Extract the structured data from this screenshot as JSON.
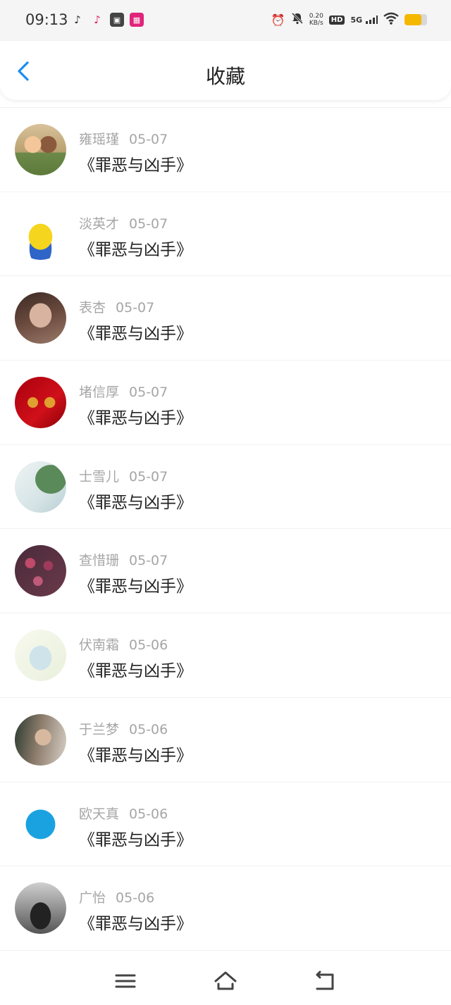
{
  "status_bar": {
    "time": "09:13",
    "speed_value": "0.20",
    "speed_unit": "KB/s",
    "hd_label": "HD",
    "network_label": "5G",
    "battery_level": 0.75,
    "accent": "#f5b800"
  },
  "header": {
    "title": "收藏",
    "back_icon": "chevron-left-icon",
    "accent": "#1b8ef2"
  },
  "favorites": [
    {
      "name": "雍瑶瑾",
      "date": "05-07",
      "book": "《罪恶与凶手》"
    },
    {
      "name": "淡英才",
      "date": "05-07",
      "book": "《罪恶与凶手》"
    },
    {
      "name": "表杏",
      "date": "05-07",
      "book": "《罪恶与凶手》"
    },
    {
      "name": "堵信厚",
      "date": "05-07",
      "book": "《罪恶与凶手》"
    },
    {
      "name": "士雪儿",
      "date": "05-07",
      "book": "《罪恶与凶手》"
    },
    {
      "name": "查惜珊",
      "date": "05-07",
      "book": "《罪恶与凶手》"
    },
    {
      "name": "伏南霜",
      "date": "05-06",
      "book": "《罪恶与凶手》"
    },
    {
      "name": "于兰梦",
      "date": "05-06",
      "book": "《罪恶与凶手》"
    },
    {
      "name": "欧天真",
      "date": "05-06",
      "book": "《罪恶与凶手》"
    },
    {
      "name": "广怡",
      "date": "05-06",
      "book": "《罪恶与凶手》"
    }
  ],
  "nav": {
    "menu_icon": "menu-icon",
    "home_icon": "home-icon",
    "back_icon": "back-arrow-icon"
  }
}
